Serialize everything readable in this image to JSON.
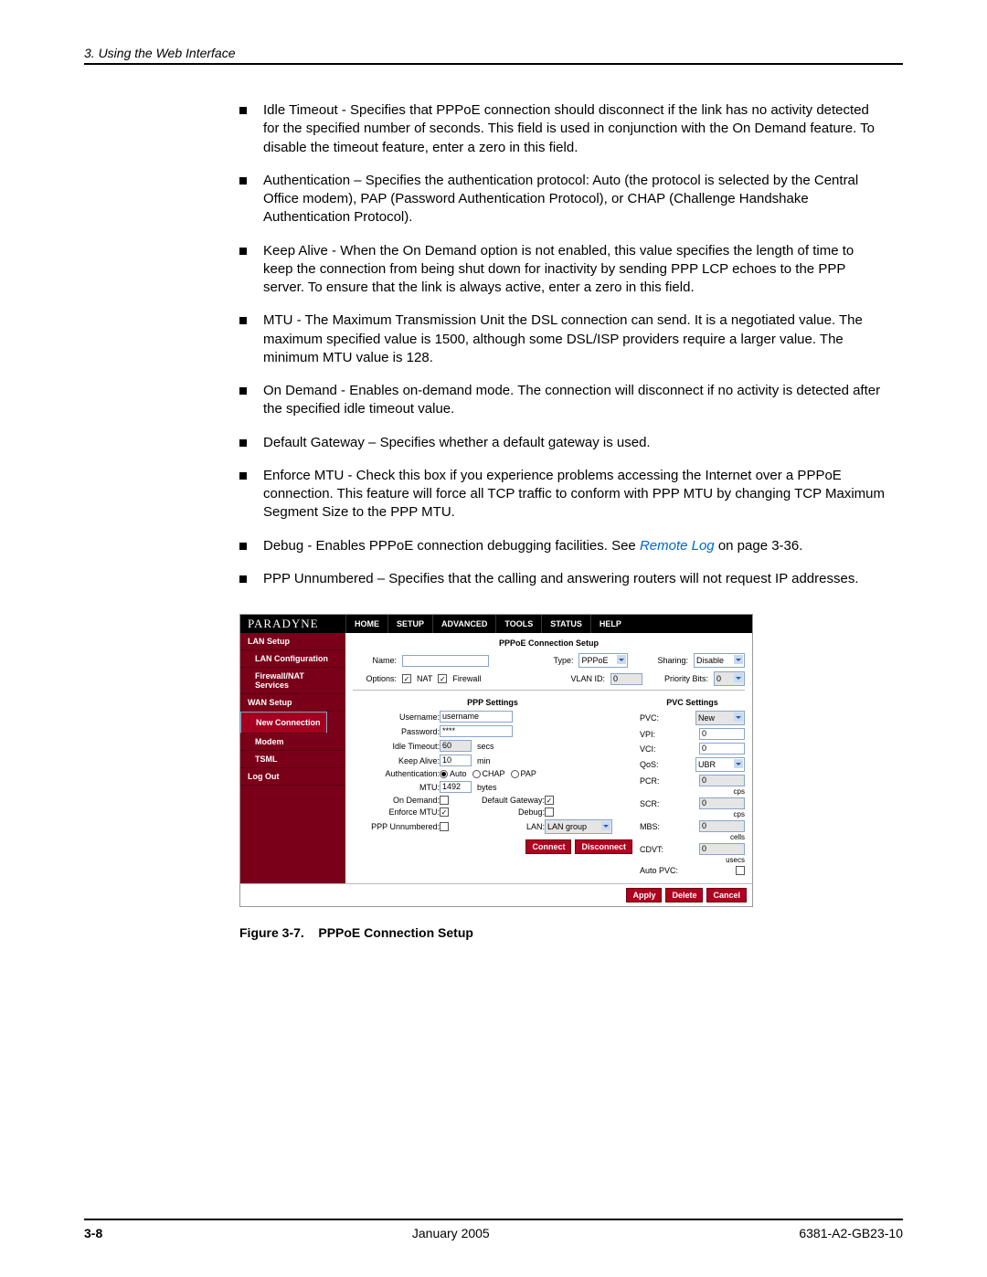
{
  "header": {
    "chapter": "3. Using the Web Interface"
  },
  "bullets": [
    "Idle Timeout - Specifies that PPPoE connection should disconnect if the link has no activity detected for the specified number of seconds. This field is used in conjunction with the On Demand feature. To disable the timeout feature, enter a zero in this field.",
    "Authentication – Specifies the authentication protocol: Auto (the protocol is selected by the Central Office modem), PAP (Password Authentication Protocol), or CHAP (Challenge Handshake Authentication Protocol).",
    "Keep Alive - When the On Demand option is not enabled, this value specifies the length of time to keep the connection from being shut down for inactivity by sending PPP LCP echoes to the PPP server. To ensure that the link is always active, enter a zero in this field.",
    "MTU - The Maximum Transmission Unit the DSL connection can send. It is a negotiated value. The maximum specified value is 1500, although some DSL/ISP providers require a larger value. The minimum MTU value is 128.",
    "On Demand - Enables on-demand mode. The connection will disconnect if no activity is detected after the specified idle timeout value.",
    "Default Gateway – Specifies whether a default gateway is used.",
    "Enforce MTU - Check this box if you experience problems accessing the Internet over a PPPoE connection. This feature will force all TCP traffic to conform with PPP MTU by changing TCP Maximum Segment Size to the PPP MTU."
  ],
  "bullet_debug": {
    "pre": "Debug - Enables PPPoE connection debugging facilities.  See ",
    "link": "Remote Log",
    "post": " on page 3-36."
  },
  "bullet_last": "PPP Unnumbered – Specifies that the calling and answering routers will not request IP addresses.",
  "figure": {
    "brand": "PARADYNE",
    "nav": [
      "HOME",
      "SETUP",
      "ADVANCED",
      "TOOLS",
      "STATUS",
      "HELP"
    ],
    "sidebar": [
      {
        "label": "LAN Setup",
        "sub": false
      },
      {
        "label": "LAN Configuration",
        "sub": true
      },
      {
        "label": "Firewall/NAT Services",
        "sub": true
      },
      {
        "label": "WAN Setup",
        "sub": false
      },
      {
        "label": "New Connection",
        "sub": true,
        "sel": true
      },
      {
        "label": "Modem",
        "sub": true
      },
      {
        "label": "TSML",
        "sub": true
      },
      {
        "label": "Log Out",
        "sub": false
      }
    ],
    "title": "PPPoE Connection Setup",
    "toprow": {
      "name_label": "Name:",
      "name_value": "",
      "type_label": "Type:",
      "type_value": "PPPoE",
      "sharing_label": "Sharing:",
      "sharing_value": "Disable",
      "options_label": "Options:",
      "nat_label": "NAT",
      "fw_label": "Firewall",
      "vlan_label": "VLAN ID:",
      "vlan_value": "0",
      "pbits_label": "Priority Bits:",
      "pbits_value": "0"
    },
    "ppp": {
      "head": "PPP Settings",
      "username_label": "Username:",
      "username_value": "username",
      "password_label": "Password:",
      "password_value": "****",
      "idle_label": "Idle Timeout:",
      "idle_value": "60",
      "idle_unit": "secs",
      "keep_label": "Keep Alive:",
      "keep_value": "10",
      "keep_unit": "min",
      "auth_label": "Authentication:",
      "auth_auto": "Auto",
      "auth_chap": "CHAP",
      "auth_pap": "PAP",
      "mtu_label": "MTU:",
      "mtu_value": "1492",
      "mtu_unit": "bytes",
      "ondemand_label": "On Demand:",
      "defgw_label": "Default Gateway:",
      "enforce_label": "Enforce MTU:",
      "debug_label": "Debug:",
      "pppun_label": "PPP Unnumbered:",
      "lan_label": "LAN:",
      "lan_value": "LAN group",
      "connect": "Connect",
      "disconnect": "Disconnect"
    },
    "pvc": {
      "head": "PVC Settings",
      "pvc_label": "PVC:",
      "pvc_value": "New",
      "vpi_label": "VPI:",
      "vpi_value": "0",
      "vci_label": "VCI:",
      "vci_value": "0",
      "qos_label": "QoS:",
      "qos_value": "UBR",
      "pcr_label": "PCR:",
      "pcr_value": "0",
      "pcr_unit": "cps",
      "scr_label": "SCR:",
      "scr_value": "0",
      "scr_unit": "cps",
      "mbs_label": "MBS:",
      "mbs_value": "0",
      "mbs_unit": "cells",
      "cdvt_label": "CDVT:",
      "cdvt_value": "0",
      "cdvt_unit": "usecs",
      "auto_label": "Auto PVC:"
    },
    "footer": {
      "apply": "Apply",
      "delete": "Delete",
      "cancel": "Cancel"
    }
  },
  "caption_label": "Figure 3-7.",
  "caption_text": "PPPoE Connection Setup",
  "footer": {
    "page": "3-8",
    "date": "January 2005",
    "doc": "6381-A2-GB23-10"
  }
}
